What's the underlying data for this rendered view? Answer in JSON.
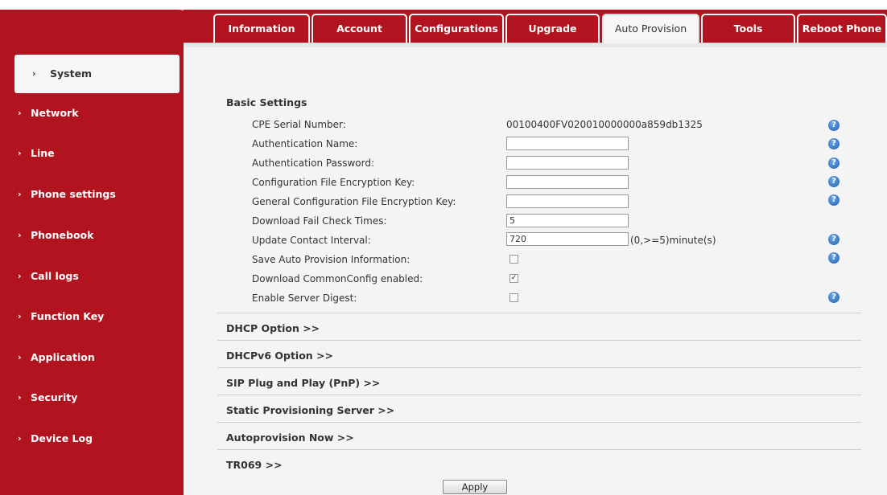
{
  "tabs": [
    {
      "label": "Information"
    },
    {
      "label": "Account"
    },
    {
      "label": "Configurations"
    },
    {
      "label": "Upgrade"
    },
    {
      "label": "Auto Provision"
    },
    {
      "label": "Tools"
    },
    {
      "label": "Reboot Phone"
    }
  ],
  "active_tab": "Auto Provision",
  "sidebar": {
    "items": [
      {
        "label": "System"
      },
      {
        "label": "Network"
      },
      {
        "label": "Line"
      },
      {
        "label": "Phone settings"
      },
      {
        "label": "Phonebook"
      },
      {
        "label": "Call logs"
      },
      {
        "label": "Function Key"
      },
      {
        "label": "Application"
      },
      {
        "label": "Security"
      },
      {
        "label": "Device Log"
      }
    ],
    "active": "System"
  },
  "basic": {
    "title": "Basic Settings",
    "cpe_label": "CPE Serial Number:",
    "cpe_value": "00100400FV020010000000a859db1325",
    "auth_name_label": "Authentication Name:",
    "auth_name_value": "",
    "auth_pass_label": "Authentication Password:",
    "auth_pass_value": "",
    "cfg_key_label": "Configuration File Encryption Key:",
    "cfg_key_value": "",
    "gen_key_label": "General Configuration File Encryption Key:",
    "gen_key_value": "",
    "fail_label": "Download Fail Check Times:",
    "fail_value": "5",
    "interval_label": "Update Contact Interval:",
    "interval_value": "720",
    "interval_unit": "(0,>=5)minute(s)",
    "save_label": "Save Auto Provision Information:",
    "save_checked": false,
    "common_label": "Download CommonConfig enabled:",
    "common_checked": true,
    "digest_label": "Enable Server Digest:",
    "digest_checked": false
  },
  "sections": [
    {
      "label": "DHCP Option >>"
    },
    {
      "label": "DHCPv6 Option >>"
    },
    {
      "label": "SIP Plug and Play (PnP) >>"
    },
    {
      "label": "Static Provisioning Server >>"
    },
    {
      "label": "Autoprovision Now >>"
    },
    {
      "label": "TR069 >>"
    }
  ],
  "sidebar_chevron": "›",
  "help_glyph": "?",
  "check_glyph": "✓",
  "apply_label": "Apply",
  "colors": {
    "brand_red": "#b1141f",
    "help_blue": "#2a6fc4"
  }
}
